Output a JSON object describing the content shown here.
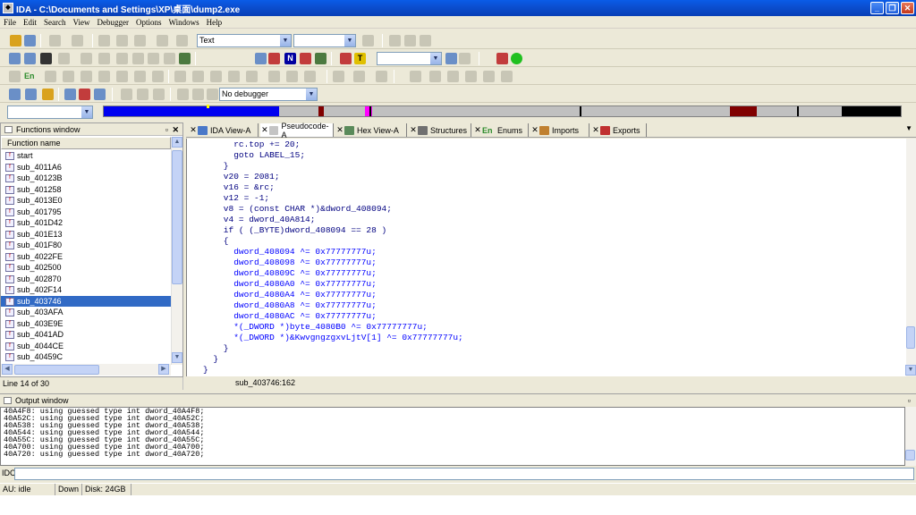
{
  "window": {
    "title": "IDA - C:\\Documents and Settings\\XP\\桌面\\dump2.exe"
  },
  "menu": [
    "File",
    "Edit",
    "Search",
    "View",
    "Debugger",
    "Options",
    "Windows",
    "Help"
  ],
  "toolbar": {
    "text_combo": "Text",
    "debugger_combo": "No debugger",
    "en_label": "En",
    "n_label": "N",
    "t_label": "T"
  },
  "functions_window": {
    "title": "Functions window",
    "column": "Function name",
    "items": [
      "start",
      "sub_4011A6",
      "sub_40123B",
      "sub_401258",
      "sub_4013E0",
      "sub_401795",
      "sub_401D42",
      "sub_401E13",
      "sub_401F80",
      "sub_4022FE",
      "sub_402500",
      "sub_402870",
      "sub_402F14",
      "sub_403746",
      "sub_403AFA",
      "sub_403E9E",
      "sub_4041AD",
      "sub_4044CE",
      "sub_40459C"
    ],
    "selected_index": 13,
    "line_status": "Line 14 of 30"
  },
  "tabs": [
    {
      "label": "IDA View-A",
      "color": "#4a78c8"
    },
    {
      "label": "Pseudocode-A",
      "color": "#c4c4c4"
    },
    {
      "label": "Hex View-A",
      "color": "#5a8a5a"
    },
    {
      "label": "Structures",
      "color": "#707070"
    },
    {
      "label": "Enums",
      "color": "#2a8a2a",
      "prefix": "En"
    },
    {
      "label": "Imports",
      "color": "#c08030"
    },
    {
      "label": "Exports",
      "color": "#c03030"
    }
  ],
  "code": {
    "lines": [
      "      rc.top += 20;",
      "      goto LABEL_15;",
      "    }",
      "    v20 = 2081;",
      "    v16 = &rc;",
      "    v12 = -1;",
      "    v8 = (const CHAR *)&dword_408094;",
      "    v4 = dword_40A814;",
      "    if ( (_BYTE)dword_408094 == 28 )",
      "    {",
      "      dword_408094 ^= 0x77777777u;",
      "      dword_408098 ^= 0x77777777u;",
      "      dword_40809C ^= 0x77777777u;",
      "      dword_4080A0 ^= 0x77777777u;",
      "      dword_4080A4 ^= 0x77777777u;",
      "      dword_4080A8 ^= 0x77777777u;",
      "      dword_4080AC ^= 0x77777777u;",
      "      *(_DWORD *)byte_4080B0 ^= 0x77777777u;",
      "      *(_DWORD *)&KwvgngzgxvLjtV[1] ^= 0x77777777u;",
      "    }",
      "  }",
      "}"
    ],
    "status": "sub_403746:162"
  },
  "output_window": {
    "title": "Output window",
    "lines": [
      "40A4F8: using guessed type int dword_40A4F8;",
      "40A52C: using guessed type int dword_40A52C;",
      "40A538: using guessed type int dword_40A538;",
      "40A544: using guessed type int dword_40A544;",
      "40A55C: using guessed type int dword_40A55C;",
      "40A700: using guessed type int dword_40A700;",
      "40A720: using guessed type int dword_40A720;"
    ],
    "idc_label": "IDC"
  },
  "statusbar": {
    "au": "AU:  idle",
    "direction": "Down",
    "disk": "Disk: 24GB"
  }
}
